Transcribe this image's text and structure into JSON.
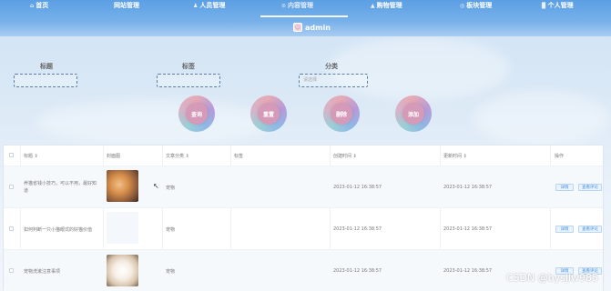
{
  "nav": {
    "items": [
      {
        "label": "首页",
        "icon": "home-icon",
        "glyph": "⌂",
        "active": false
      },
      {
        "label": "网站管理",
        "icon": "",
        "glyph": "",
        "active": false
      },
      {
        "label": "人员管理",
        "icon": "user-icon",
        "glyph": "♟",
        "active": false
      },
      {
        "label": "内容管理",
        "icon": "content-icon",
        "glyph": "⊙",
        "active": true
      },
      {
        "label": "购物管理",
        "icon": "cart-icon",
        "glyph": "▲",
        "active": false
      },
      {
        "label": "板块管理",
        "icon": "grid-icon",
        "glyph": "◎",
        "active": false
      },
      {
        "label": "个人管理",
        "icon": "person-icon",
        "glyph": "▉",
        "active": false
      }
    ],
    "user": {
      "name": "admin",
      "avatar_icon": "avatar-icon"
    }
  },
  "search": {
    "title_label": "标题",
    "tag_label": "标签",
    "category_label": "分类",
    "category_placeholder": "请选择",
    "buttons": {
      "query": "查询",
      "reset": "重置",
      "delete": "删除",
      "add": "添加"
    }
  },
  "table": {
    "headers": [
      "标题 ⇕",
      "封面图",
      "文章分类 ⇕",
      "标签",
      "创建时间 ⇕",
      "更新时间 ⇕",
      "操作"
    ],
    "rows": [
      {
        "title": "养猫省钱小技巧，可以不用，最好知道",
        "category": "宠物",
        "tag": "",
        "created": "2023-01-12 16:38:57",
        "updated": "2023-01-12 16:38:57"
      },
      {
        "title": "如何判断一只小猫眼式的好猫价值",
        "category": "宠物",
        "tag": "",
        "created": "2023-01-12 16:38:57",
        "updated": "2023-01-12 16:38:57"
      },
      {
        "title": "宠物洗漱注意事项",
        "category": "宠物",
        "tag": "",
        "created": "2023-01-12 16:38:57",
        "updated": "2023-01-12 16:38:57"
      }
    ],
    "actions": {
      "detail": "详情",
      "view_comments": "查看评论"
    }
  },
  "watermark": "CSDN @bysjlw985",
  "colors": {
    "nav": "#5b9fe4",
    "accent": "#4a90d9",
    "button": "#d59ab8"
  }
}
